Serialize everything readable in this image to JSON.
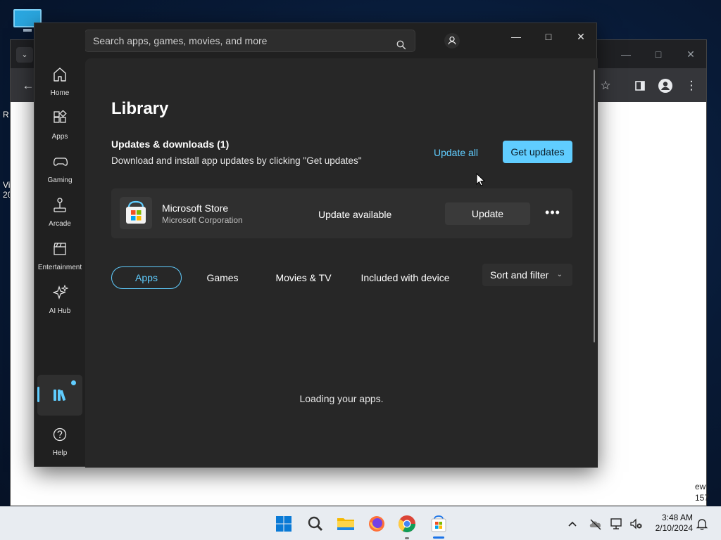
{
  "desktop": {
    "left_fragments": [
      "R",
      "Vi",
      "20"
    ],
    "right_fragments": [
      "ew",
      "157"
    ]
  },
  "store": {
    "search_placeholder": "Search apps, games, movies, and more",
    "nav": {
      "home": "Home",
      "apps": "Apps",
      "gaming": "Gaming",
      "arcade": "Arcade",
      "entertainment": "Entertainment",
      "ai_hub": "AI Hub",
      "help": "Help"
    },
    "page_title": "Library",
    "updates_heading": "Updates & downloads (1)",
    "updates_sub": "Download and install app updates by clicking \"Get updates\"",
    "update_all_label": "Update all",
    "get_updates_label": "Get updates",
    "update_item": {
      "name": "Microsoft Store",
      "publisher": "Microsoft Corporation",
      "status": "Update available",
      "action_label": "Update",
      "more_label": "•••"
    },
    "filters": [
      "Apps",
      "Games",
      "Movies & TV",
      "Included with device"
    ],
    "active_filter": "Apps",
    "sort_label": "Sort and filter",
    "loading_text": "Loading your apps."
  },
  "taskbar": {
    "time": "3:48 AM",
    "date": "2/10/2024"
  },
  "colors": {
    "accent": "#60cdff",
    "store_bg": "#202020",
    "content_bg": "#272727",
    "card_bg": "#2f2f2f"
  }
}
